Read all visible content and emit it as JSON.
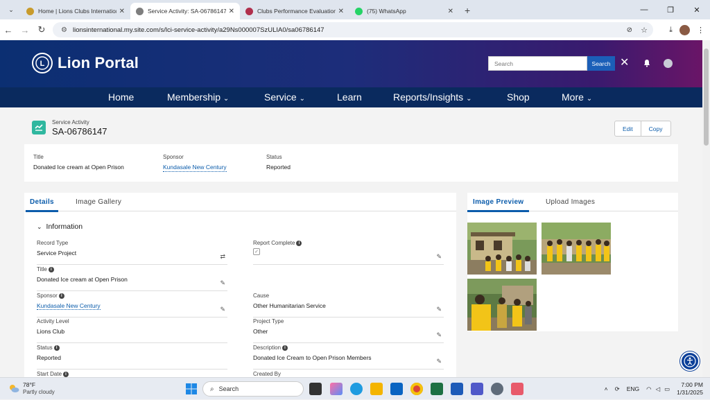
{
  "browser": {
    "tabs": [
      {
        "title": "Home | Lions Clubs Internationa...",
        "favicon": "#c89b2c",
        "active": false
      },
      {
        "title": "Service Activity: SA-06786147",
        "favicon": "#7e7e7e",
        "active": true
      },
      {
        "title": "Clubs Performance Evaluation S...",
        "favicon": "#b02f4c",
        "active": false
      },
      {
        "title": "(75) WhatsApp",
        "favicon": "#25d366",
        "active": false
      }
    ],
    "url": "lionsinternational.my.site.com/s/lci-service-activity/a29Ns000007SzULIA0/sa06786147"
  },
  "portal": {
    "brand": "Lion Portal",
    "logo_text": "LIONS",
    "search_placeholder": "Search",
    "search_button": "Search",
    "nav": [
      {
        "label": "Home",
        "dropdown": false
      },
      {
        "label": "Membership",
        "dropdown": true
      },
      {
        "label": "Service",
        "dropdown": true
      },
      {
        "label": "Learn",
        "dropdown": false
      },
      {
        "label": "Reports/Insights",
        "dropdown": true
      },
      {
        "label": "Shop",
        "dropdown": false
      },
      {
        "label": "More",
        "dropdown": true
      }
    ]
  },
  "record": {
    "type_label": "Service Activity",
    "name": "SA-06786147",
    "edit_button": "Edit",
    "copy_button": "Copy",
    "highlights": {
      "title_label": "Title",
      "title_value": "Donated Ice cream at Open Prison",
      "sponsor_label": "Sponsor",
      "sponsor_value": "Kundasale New Century",
      "status_label": "Status",
      "status_value": "Reported"
    },
    "tabs": {
      "details": "Details",
      "gallery": "Image Gallery"
    },
    "section_title": "Information",
    "fields": {
      "record_type_label": "Record Type",
      "record_type_value": "Service Project",
      "report_complete_label": "Report Complete",
      "report_complete_checked": true,
      "title_label": "Title",
      "title_value": "Donated Ice cream at Open Prison",
      "sponsor_label": "Sponsor",
      "sponsor_value": "Kundasale New Century",
      "cause_label": "Cause",
      "cause_value": "Other Humanitarian Service",
      "activity_level_label": "Activity Level",
      "activity_level_value": "Lions Club",
      "project_type_label": "Project Type",
      "project_type_value": "Other",
      "status_label": "Status",
      "status_value": "Reported",
      "description_label": "Description",
      "description_value": "Donated Ice Cream to Open Prison Members",
      "start_date_label": "Start Date",
      "created_by_label": "Created By"
    },
    "image_tabs": {
      "preview": "Image Preview",
      "upload": "Upload Images"
    }
  },
  "taskbar": {
    "temperature": "78°F",
    "condition": "Partly cloudy",
    "search_placeholder": "Search",
    "lang": "ENG",
    "time": "7:00 PM",
    "date": "1/31/2025"
  },
  "colors": {
    "accent": "#0b5cab",
    "nav_bg": "#0a2a5e",
    "record_icon": "#2fb79f"
  }
}
